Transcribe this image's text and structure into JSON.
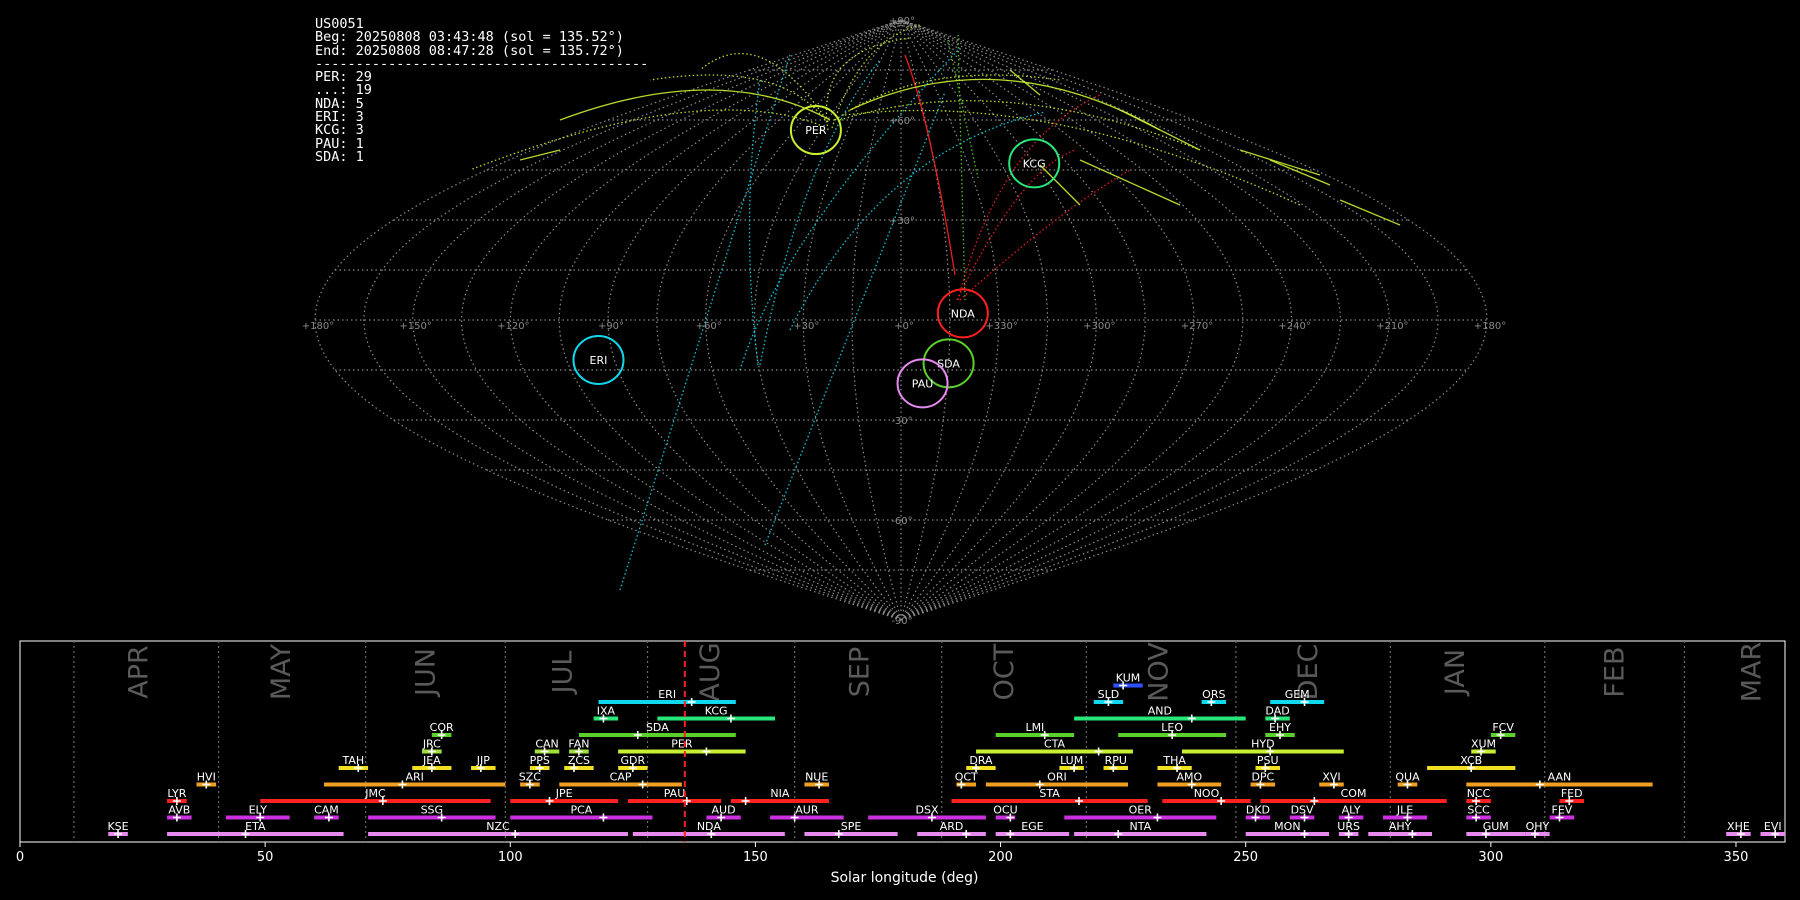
{
  "info": {
    "station": "US0051",
    "begin": "Beg: 20250808 03:43:48 (sol = 135.52°)",
    "end": "End: 20250808 08:47:28 (sol = 135.72°)",
    "separator": "-----------------------------------------",
    "counts": [
      "PER: 29",
      "...: 19",
      "NDA: 5",
      "ERI: 3",
      "KCG: 3",
      "PAU: 1",
      "SDA: 1"
    ]
  },
  "chart_data": [
    {
      "type": "scatter",
      "projection": "sinusoidal",
      "lon_ticks": [
        "+180°",
        "+150°",
        "+120°",
        "+90°",
        "+60°",
        "+30°",
        "+0°",
        "+330°",
        "+300°",
        "+270°",
        "+240°",
        "+210°",
        "+180°"
      ],
      "lat_ticks": [
        "+90°",
        "+60°",
        "+30°",
        "-30°",
        "-60°",
        "-90°"
      ],
      "radiants": [
        {
          "name": "PER",
          "lon": 48,
          "lat": 57,
          "color": "#c8f032"
        },
        {
          "name": "KCG",
          "lon": -60,
          "lat": 47,
          "color": "#28e67a"
        },
        {
          "name": "NDA",
          "lon": -19,
          "lat": 2,
          "color": "#ff2020"
        },
        {
          "name": "ERI",
          "lon": 95,
          "lat": -12,
          "color": "#10d8ee"
        },
        {
          "name": "SDA",
          "lon": -15,
          "lat": -13,
          "color": "#5cd02a"
        },
        {
          "name": "PAU",
          "lon": -7,
          "lat": -19,
          "color": "#e68aee"
        }
      ]
    },
    {
      "type": "bar",
      "xlabel": "Solar longitude (deg)",
      "xlim": [
        0,
        360
      ],
      "xticks": [
        "0",
        "50",
        "100",
        "150",
        "200",
        "250",
        "300",
        "350"
      ],
      "months": [
        {
          "name": "APR",
          "at": 24.5
        },
        {
          "name": "MAY",
          "at": 53.5
        },
        {
          "name": "JUN",
          "at": 83
        },
        {
          "name": "JUL",
          "at": 111
        },
        {
          "name": "AUG",
          "at": 141
        },
        {
          "name": "SEP",
          "at": 171.5
        },
        {
          "name": "OCT",
          "at": 201
        },
        {
          "name": "NOV",
          "at": 232.5
        },
        {
          "name": "DEC",
          "at": 263
        },
        {
          "name": "JAN",
          "at": 293
        },
        {
          "name": "FEB",
          "at": 325.5
        },
        {
          "name": "MAR",
          "at": 353.5
        }
      ],
      "month_bounds": [
        11,
        40.5,
        70.5,
        99,
        128,
        158,
        188,
        217.5,
        248,
        279.5,
        311,
        339.5
      ],
      "current_sol": 135.6,
      "showers": [
        {
          "code": "KUM",
          "start": 223,
          "end": 229,
          "peak": 225,
          "row": 9,
          "color": "#3050ff"
        },
        {
          "code": "ERI",
          "start": 118,
          "end": 146,
          "peak": 137,
          "row": 8,
          "color": "#10d8ee"
        },
        {
          "code": "SLD",
          "start": 219,
          "end": 225,
          "peak": 222,
          "row": 8,
          "color": "#10d8ee"
        },
        {
          "code": "ORS",
          "start": 241,
          "end": 246,
          "peak": 243,
          "row": 8,
          "color": "#10d8ee"
        },
        {
          "code": "GEM",
          "start": 255,
          "end": 266,
          "peak": 262,
          "row": 8,
          "color": "#10d8ee"
        },
        {
          "code": "IXA",
          "start": 117,
          "end": 122,
          "peak": 119,
          "row": 7,
          "color": "#28e67a"
        },
        {
          "code": "KCG",
          "start": 130,
          "end": 154,
          "peak": 145,
          "row": 7,
          "color": "#28e67a"
        },
        {
          "code": "AND",
          "start": 215,
          "end": 250,
          "peak": 239,
          "row": 7,
          "color": "#28e67a"
        },
        {
          "code": "DAD",
          "start": 254,
          "end": 259,
          "peak": 256,
          "row": 7,
          "color": "#28e67a"
        },
        {
          "code": "COR",
          "start": 84,
          "end": 88,
          "peak": 86,
          "row": 6,
          "color": "#5cd02a"
        },
        {
          "code": "SDA",
          "start": 114,
          "end": 146,
          "peak": 126,
          "row": 6,
          "color": "#5cd02a"
        },
        {
          "code": "LMI",
          "start": 199,
          "end": 215,
          "peak": 209,
          "row": 6,
          "color": "#5cd02a"
        },
        {
          "code": "LEO",
          "start": 224,
          "end": 246,
          "peak": 235,
          "row": 6,
          "color": "#5cd02a"
        },
        {
          "code": "EHY",
          "start": 254,
          "end": 260,
          "peak": 257,
          "row": 6,
          "color": "#5cd02a"
        },
        {
          "code": "FCV",
          "start": 300,
          "end": 305,
          "peak": 302,
          "row": 6,
          "color": "#5cd02a"
        },
        {
          "code": "JRC",
          "start": 82,
          "end": 86,
          "peak": 84,
          "row": 5,
          "color": "#9fe03a"
        },
        {
          "code": "CAN",
          "start": 105,
          "end": 110,
          "peak": 107,
          "row": 5,
          "color": "#9fe03a"
        },
        {
          "code": "FAN",
          "start": 112,
          "end": 116,
          "peak": 114,
          "row": 5,
          "color": "#9fe03a"
        },
        {
          "code": "PER",
          "start": 122,
          "end": 148,
          "peak": 140,
          "row": 5,
          "color": "#c8f032"
        },
        {
          "code": "CTA",
          "start": 195,
          "end": 227,
          "peak": 220,
          "row": 5,
          "color": "#c8f032"
        },
        {
          "code": "HYD",
          "start": 237,
          "end": 270,
          "peak": 255,
          "row": 5,
          "color": "#c8f032"
        },
        {
          "code": "XUM",
          "start": 296,
          "end": 301,
          "peak": 298,
          "row": 5,
          "color": "#c8f032"
        },
        {
          "code": "TAH",
          "start": 65,
          "end": 71,
          "peak": 69,
          "row": 4,
          "color": "#f0e020"
        },
        {
          "code": "JEA",
          "start": 80,
          "end": 88,
          "peak": 84,
          "row": 4,
          "color": "#f0e020"
        },
        {
          "code": "JIP",
          "start": 92,
          "end": 97,
          "peak": 94,
          "row": 4,
          "color": "#f0e020"
        },
        {
          "code": "PPS",
          "start": 104,
          "end": 108,
          "peak": 106,
          "row": 4,
          "color": "#f0e020"
        },
        {
          "code": "ZCS",
          "start": 111,
          "end": 117,
          "peak": 113,
          "row": 4,
          "color": "#f0e020"
        },
        {
          "code": "GDR",
          "start": 122,
          "end": 128,
          "peak": 125,
          "row": 4,
          "color": "#f0e020"
        },
        {
          "code": "DRA",
          "start": 193,
          "end": 199,
          "peak": 195,
          "row": 4,
          "color": "#f0e020"
        },
        {
          "code": "LUM",
          "start": 212,
          "end": 217,
          "peak": 215,
          "row": 4,
          "color": "#f0e020"
        },
        {
          "code": "RPU",
          "start": 221,
          "end": 226,
          "peak": 223,
          "row": 4,
          "color": "#f0e020"
        },
        {
          "code": "THA",
          "start": 232,
          "end": 239,
          "peak": 236,
          "row": 4,
          "color": "#f0e020"
        },
        {
          "code": "PSU",
          "start": 252,
          "end": 257,
          "peak": 254,
          "row": 4,
          "color": "#f0e020"
        },
        {
          "code": "XCB",
          "start": 287,
          "end": 305,
          "peak": 296,
          "row": 4,
          "color": "#f0e020"
        },
        {
          "code": "HVI",
          "start": 36,
          "end": 40,
          "peak": 38,
          "row": 3,
          "color": "#f0a020"
        },
        {
          "code": "ARI",
          "start": 62,
          "end": 99,
          "peak": 78,
          "row": 3,
          "color": "#f0a020"
        },
        {
          "code": "SZC",
          "start": 102,
          "end": 106,
          "peak": 104,
          "row": 3,
          "color": "#f0a020"
        },
        {
          "code": "CAP",
          "start": 110,
          "end": 135,
          "peak": 127,
          "row": 3,
          "color": "#f0a020"
        },
        {
          "code": "NUE",
          "start": 160,
          "end": 165,
          "peak": 163,
          "row": 3,
          "color": "#f0a020"
        },
        {
          "code": "OCT",
          "start": 191,
          "end": 195,
          "peak": 192,
          "row": 3,
          "color": "#f0a020"
        },
        {
          "code": "ORI",
          "start": 197,
          "end": 226,
          "peak": 208,
          "row": 3,
          "color": "#f0a020"
        },
        {
          "code": "AMO",
          "start": 232,
          "end": 245,
          "peak": 239,
          "row": 3,
          "color": "#f0a020"
        },
        {
          "code": "DPC",
          "start": 251,
          "end": 256,
          "peak": 253,
          "row": 3,
          "color": "#f0a020"
        },
        {
          "code": "XVI",
          "start": 265,
          "end": 270,
          "peak": 268,
          "row": 3,
          "color": "#f0a020"
        },
        {
          "code": "QUA",
          "start": 281,
          "end": 285,
          "peak": 283,
          "row": 3,
          "color": "#f0a020"
        },
        {
          "code": "AAN",
          "start": 295,
          "end": 333,
          "peak": 310,
          "row": 3,
          "color": "#f0a020"
        },
        {
          "code": "LYR",
          "start": 30,
          "end": 34,
          "peak": 32,
          "row": 2,
          "color": "#ff2020"
        },
        {
          "code": "JMC",
          "start": 49,
          "end": 96,
          "peak": 74,
          "row": 2,
          "color": "#ff2020"
        },
        {
          "code": "JPE",
          "start": 100,
          "end": 122,
          "peak": 108,
          "row": 2,
          "color": "#ff2020"
        },
        {
          "code": "PAU",
          "start": 124,
          "end": 143,
          "peak": 136,
          "row": 2,
          "color": "#ff2020"
        },
        {
          "code": "NIA",
          "start": 145,
          "end": 165,
          "peak": 148,
          "row": 2,
          "color": "#ff2020"
        },
        {
          "code": "STA",
          "start": 190,
          "end": 230,
          "peak": 216,
          "row": 2,
          "color": "#ff2020"
        },
        {
          "code": "NOO",
          "start": 233,
          "end": 251,
          "peak": 245,
          "row": 2,
          "color": "#ff2020"
        },
        {
          "code": "COM",
          "start": 253,
          "end": 291,
          "peak": 264,
          "row": 2,
          "color": "#ff2020"
        },
        {
          "code": "NCC",
          "start": 295,
          "end": 300,
          "peak": 297,
          "row": 2,
          "color": "#ff2020"
        },
        {
          "code": "FED",
          "start": 314,
          "end": 319,
          "peak": 316,
          "row": 2,
          "color": "#ff2020"
        },
        {
          "code": "AVB",
          "start": 30,
          "end": 35,
          "peak": 32,
          "row": 1,
          "color": "#cc30e0"
        },
        {
          "code": "ELY",
          "start": 42,
          "end": 55,
          "peak": 49,
          "row": 1,
          "color": "#cc30e0"
        },
        {
          "code": "CAM",
          "start": 60,
          "end": 65,
          "peak": 63,
          "row": 1,
          "color": "#cc30e0"
        },
        {
          "code": "SSG",
          "start": 71,
          "end": 97,
          "peak": 86,
          "row": 1,
          "color": "#cc30e0"
        },
        {
          "code": "PCA",
          "start": 100,
          "end": 129,
          "peak": 119,
          "row": 1,
          "color": "#cc30e0"
        },
        {
          "code": "AUD",
          "start": 140,
          "end": 147,
          "peak": 143,
          "row": 1,
          "color": "#cc30e0"
        },
        {
          "code": "AUR",
          "start": 153,
          "end": 168,
          "peak": 158,
          "row": 1,
          "color": "#cc30e0"
        },
        {
          "code": "DSX",
          "start": 173,
          "end": 197,
          "peak": 186,
          "row": 1,
          "color": "#cc30e0"
        },
        {
          "code": "OCU",
          "start": 199,
          "end": 203,
          "peak": 202,
          "row": 1,
          "color": "#cc30e0"
        },
        {
          "code": "OER",
          "start": 213,
          "end": 244,
          "peak": 232,
          "row": 1,
          "color": "#cc30e0"
        },
        {
          "code": "DKD",
          "start": 250,
          "end": 255,
          "peak": 252,
          "row": 1,
          "color": "#cc30e0"
        },
        {
          "code": "DSV",
          "start": 259,
          "end": 264,
          "peak": 262,
          "row": 1,
          "color": "#cc30e0"
        },
        {
          "code": "ALY",
          "start": 269,
          "end": 274,
          "peak": 271,
          "row": 1,
          "color": "#cc30e0"
        },
        {
          "code": "JLE",
          "start": 278,
          "end": 287,
          "peak": 283,
          "row": 1,
          "color": "#cc30e0"
        },
        {
          "code": "SCC",
          "start": 295,
          "end": 300,
          "peak": 297,
          "row": 1,
          "color": "#cc30e0"
        },
        {
          "code": "FEV",
          "start": 312,
          "end": 317,
          "peak": 314,
          "row": 1,
          "color": "#cc30e0"
        },
        {
          "code": "KSE",
          "start": 18,
          "end": 22,
          "peak": 20,
          "row": 0,
          "color": "#e68aee"
        },
        {
          "code": "ETA",
          "start": 30,
          "end": 66,
          "peak": 46,
          "row": 0,
          "color": "#e68aee"
        },
        {
          "code": "NZC",
          "start": 71,
          "end": 124,
          "peak": 101,
          "row": 0,
          "color": "#e68aee"
        },
        {
          "code": "NDA",
          "start": 125,
          "end": 156,
          "peak": 141,
          "row": 0,
          "color": "#e68aee"
        },
        {
          "code": "SPE",
          "start": 160,
          "end": 179,
          "peak": 167,
          "row": 0,
          "color": "#e68aee"
        },
        {
          "code": "ARD",
          "start": 183,
          "end": 197,
          "peak": 193,
          "row": 0,
          "color": "#e68aee"
        },
        {
          "code": "EGE",
          "start": 199,
          "end": 214,
          "peak": 202,
          "row": 0,
          "color": "#e68aee"
        },
        {
          "code": "NTA",
          "start": 215,
          "end": 242,
          "peak": 224,
          "row": 0,
          "color": "#e68aee"
        },
        {
          "code": "MON",
          "start": 250,
          "end": 267,
          "peak": 262,
          "row": 0,
          "color": "#e68aee"
        },
        {
          "code": "URS",
          "start": 269,
          "end": 273,
          "peak": 271,
          "row": 0,
          "color": "#e68aee"
        },
        {
          "code": "AHY",
          "start": 275,
          "end": 288,
          "peak": 284,
          "row": 0,
          "color": "#e68aee"
        },
        {
          "code": "GUM",
          "start": 295,
          "end": 307,
          "peak": 299,
          "row": 0,
          "color": "#e68aee"
        },
        {
          "code": "OHY",
          "start": 307,
          "end": 312,
          "peak": 309,
          "row": 0,
          "color": "#e68aee"
        },
        {
          "code": "XHE",
          "start": 348,
          "end": 353,
          "peak": 351,
          "row": 0,
          "color": "#e68aee"
        },
        {
          "code": "EVI",
          "start": 355,
          "end": 360,
          "peak": 358,
          "row": 0,
          "color": "#e68aee"
        }
      ]
    }
  ]
}
